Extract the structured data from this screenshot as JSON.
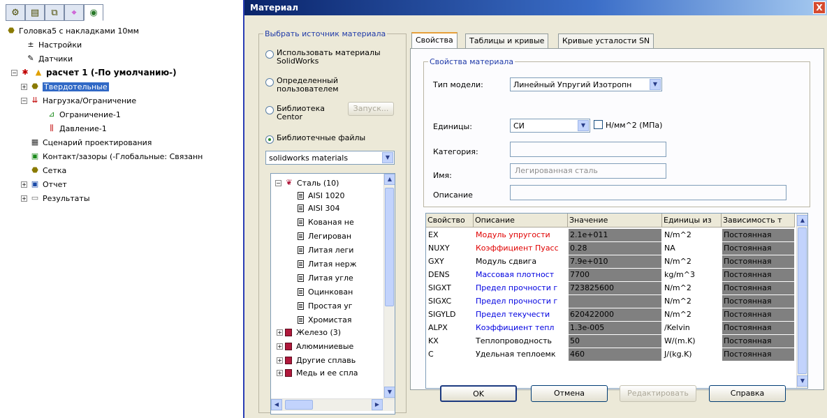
{
  "tree": {
    "toolbar_icons": [
      "feature-manager-icon",
      "property-manager-icon",
      "configuration-manager-icon",
      "dimxpert-icon",
      "simulation-icon"
    ],
    "nodes": [
      {
        "label": "Головка5 с накладками 10мм"
      },
      {
        "label": "Настройки"
      },
      {
        "label": "Датчики"
      },
      {
        "label": "расчет 1 (-По умолчанию-)"
      },
      {
        "label": "Твердотельные"
      },
      {
        "label": "Нагрузка/Ограничение"
      },
      {
        "label": "Ограничение-1"
      },
      {
        "label": "Давление-1"
      },
      {
        "label": "Сценарий проектирования"
      },
      {
        "label": "Контакт/зазоры (-Глобальные: Связанн"
      },
      {
        "label": "Сетка"
      },
      {
        "label": "Отчет"
      },
      {
        "label": "Результаты"
      }
    ]
  },
  "dialog": {
    "title": "Материал",
    "close_label": "X",
    "source_group": {
      "legend": "Выбрать источник материала",
      "radios": [
        {
          "label1": "Использовать материалы",
          "label2": "SolidWorks",
          "checked": false
        },
        {
          "label1": "Определенный",
          "label2": "пользователем",
          "checked": false
        },
        {
          "label1": "Библиотека",
          "label2": "Centor",
          "checked": false
        },
        {
          "label1": "Библиотечные файлы",
          "label2": "",
          "checked": true
        }
      ],
      "launch_button": "Запуск...",
      "library_file": "solidworks materials"
    },
    "library_tree": [
      {
        "label": "Сталь (10)",
        "type": "folder-open"
      },
      {
        "label": "AISI 1020",
        "type": "material"
      },
      {
        "label": "AISI 304",
        "type": "material"
      },
      {
        "label": "Кованая не",
        "type": "material"
      },
      {
        "label": "Легирован",
        "type": "material"
      },
      {
        "label": "Литая леги",
        "type": "material"
      },
      {
        "label": "Литая нерж",
        "type": "material"
      },
      {
        "label": "Литая угле",
        "type": "material"
      },
      {
        "label": "Оцинкован",
        "type": "material"
      },
      {
        "label": "Простая уг",
        "type": "material"
      },
      {
        "label": "Хромистая",
        "type": "material"
      },
      {
        "label": "Железо (3)",
        "type": "folder"
      },
      {
        "label": "Алюминиевые",
        "type": "folder"
      },
      {
        "label": "Другие сплавь",
        "type": "folder"
      },
      {
        "label": "Медь и ее спла",
        "type": "folder"
      }
    ],
    "tabs": [
      "Свойства",
      "Таблицы и кривые",
      "Кривые усталости SN"
    ],
    "props_group": {
      "legend": "Свойства материала",
      "model_type_label": "Тип модели:",
      "model_type_value": "Линейный Упругий Изотропн",
      "units_label": "Единицы:",
      "units_value": "СИ",
      "units_check_label": "Н/мм^2 (МПа)",
      "category_label": "Категория:",
      "category_value": "",
      "name_label": "Имя:",
      "name_value": "Легированная сталь",
      "description_label": "Описание",
      "description_value": ""
    },
    "grid": {
      "headers": [
        "Свойство",
        "Описание",
        "Значение",
        "Единицы из",
        "Зависимость т"
      ],
      "rows": [
        {
          "prop": "EX",
          "desc": "Модуль упругости",
          "value": "2.1e+011",
          "units": "N/m^2",
          "dep": "Постоянная",
          "color": "red"
        },
        {
          "prop": "NUXY",
          "desc": "Коэффициент Пуасс",
          "value": "0.28",
          "units": "NA",
          "dep": "Постоянная",
          "color": "red"
        },
        {
          "prop": "GXY",
          "desc": "Модуль сдвига",
          "value": "7.9e+010",
          "units": "N/m^2",
          "dep": "Постоянная",
          "color": "black"
        },
        {
          "prop": "DENS",
          "desc": "Массовая плотност",
          "value": "7700",
          "units": "kg/m^3",
          "dep": "Постоянная",
          "color": "blue"
        },
        {
          "prop": "SIGXT",
          "desc": "Предел прочности г",
          "value": "723825600",
          "units": "N/m^2",
          "dep": "Постоянная",
          "color": "blue"
        },
        {
          "prop": "SIGXC",
          "desc": "Предел прочности г",
          "value": "",
          "units": "N/m^2",
          "dep": "Постоянная",
          "color": "blue"
        },
        {
          "prop": "SIGYLD",
          "desc": "Предел текучести",
          "value": "620422000",
          "units": "N/m^2",
          "dep": "Постоянная",
          "color": "blue"
        },
        {
          "prop": "ALPX",
          "desc": "Коэффициент тепл",
          "value": "1.3e-005",
          "units": "/Kelvin",
          "dep": "Постоянная",
          "color": "blue"
        },
        {
          "prop": "KX",
          "desc": "Теплопроводность",
          "value": "50",
          "units": "W/(m.K)",
          "dep": "Постоянная",
          "color": "black"
        },
        {
          "prop": "C",
          "desc": "Удельная теплоемк",
          "value": "460",
          "units": "J/(kg.K)",
          "dep": "Постоянная",
          "color": "black"
        }
      ]
    },
    "buttons": {
      "ok": "OK",
      "cancel": "Отмена",
      "edit": "Редактировать",
      "help": "Справка"
    }
  }
}
